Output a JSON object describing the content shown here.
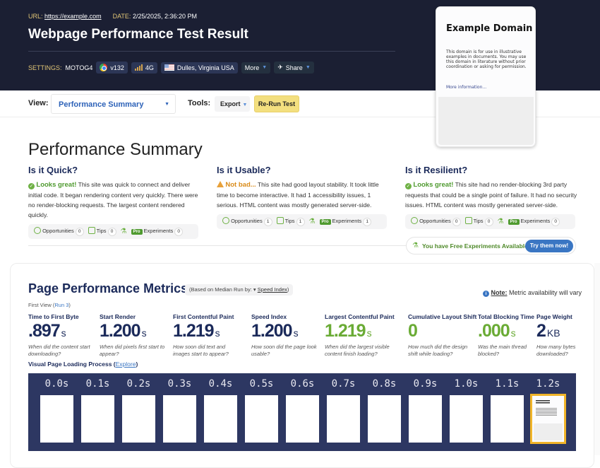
{
  "header": {
    "url_label": "URL:",
    "url": "https://example.com",
    "date_label": "DATE:",
    "date": "2/25/2025, 2:36:20 PM",
    "title": "Webpage Performance Test Result",
    "settings_label": "SETTINGS:",
    "device": "MOTOG4",
    "browser": "v132",
    "connection": "4G",
    "location": "Dulles, Virginia USA",
    "more_label": "More",
    "share_label": "Share"
  },
  "preview": {
    "heading": "Example Domain",
    "body": "This domain is for use in illustrative examples in documents. You may use this domain in literature without prior coordination or asking for permission.",
    "link": "More information..."
  },
  "toolbar": {
    "view_label": "View:",
    "view_value": "Performance Summary",
    "tools_label": "Tools:",
    "export_label": "Export",
    "rerun_label": "Re-Run Test"
  },
  "summary": {
    "title": "Performance Summary",
    "columns": [
      {
        "heading": "Is it Quick?",
        "status": "good",
        "verdict": "Looks great!",
        "text": " This site was quick to connect and deliver initial code. It began rendering content very quickly. There were no render-blocking requests. The largest content rendered quickly.",
        "opportunities": "0",
        "tips": "0",
        "experiments": "0"
      },
      {
        "heading": "Is it Usable?",
        "status": "warn",
        "verdict": "Not bad...",
        "text": " This site had good layout stability. It took little time to become interactive. It had 1 accessibility issues, 1 serious. HTML content was mostly generated server-side.",
        "opportunities": "1",
        "tips": "1",
        "experiments": "1"
      },
      {
        "heading": "Is it Resilient?",
        "status": "good",
        "verdict": "Looks great!",
        "text": " This site had no render-blocking 3rd party requests that could be a single point of failure. It had no security issues. HTML content was mostly generated server-side.",
        "opportunities": "0",
        "tips": "0",
        "experiments": "0"
      }
    ],
    "labels": {
      "opportunities": "Opportunities",
      "tips": "Tips",
      "pro": "Pro",
      "experiments": "Experiments"
    },
    "free_experiments": "You have Free Experiments Available!",
    "try_button": "Try them now!"
  },
  "metrics": {
    "title": "Page Performance Metrics",
    "median_prefix": "(Based on Median Run by: ",
    "median_link": "Speed Index",
    "median_suffix": ")",
    "note_label": "Note:",
    "note_text": " Metric availability will vary",
    "first_view": "First View (",
    "run_link": "Run 3",
    "first_view_end": ")",
    "items": [
      {
        "name": "Time to First Byte",
        "value": ".897",
        "unit": "s",
        "desc": "When did the content start downloading?",
        "color": "navy"
      },
      {
        "name": "Start Render",
        "value": "1.200",
        "unit": "s",
        "desc": "When did pixels first start to appear?",
        "color": "navy"
      },
      {
        "name": "First Contentful Paint",
        "value": "1.219",
        "unit": "s",
        "desc": "How soon did text and images start to appear?",
        "color": "navy"
      },
      {
        "name": "Speed Index",
        "value": "1.200",
        "unit": "s",
        "desc": "How soon did the page look usable?",
        "color": "navy"
      },
      {
        "name": "Largest Contentful Paint",
        "value": "1.219",
        "unit": "s",
        "desc": "When did the largest visible content finish loading?",
        "color": "green"
      },
      {
        "name": "Cumulative Layout Shift",
        "value": "0",
        "unit": "",
        "desc": "How much did the design shift while loading?",
        "color": "green"
      },
      {
        "name": "Total Blocking Time",
        "value": ".000",
        "unit": "s",
        "desc": "Was the main thread blocked?",
        "color": "green"
      },
      {
        "name": "Page Weight",
        "value": "2",
        "unit": "KB",
        "desc": "How many bytes downloaded?",
        "color": "navy"
      }
    ],
    "visual_label": "Visual Page Loading Process",
    "explore_link": "Explore",
    "frames": [
      "0.0s",
      "0.1s",
      "0.2s",
      "0.3s",
      "0.4s",
      "0.5s",
      "0.6s",
      "0.7s",
      "0.8s",
      "0.9s",
      "1.0s",
      "1.1s",
      "1.2s"
    ]
  }
}
